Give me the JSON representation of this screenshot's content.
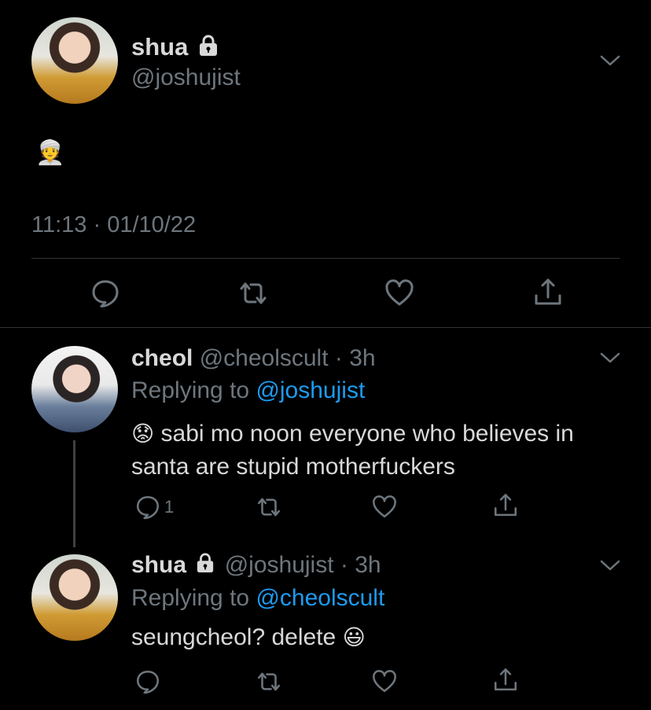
{
  "main_tweet": {
    "display_name": "shua",
    "handle": "@joshujist",
    "emoji": "👳",
    "time": "11:13 · 01/10/22"
  },
  "reply1": {
    "display_name": "cheol",
    "handle": "@cheolscult",
    "time": "· 3h",
    "replying_label": "Replying to",
    "replying_to": "@joshujist",
    "emoji": "😟",
    "text_line1": "sabi mo noon everyone who believes in",
    "text_line2": "santa are stupid motherfuckers",
    "reply_count": "1"
  },
  "reply2": {
    "display_name": "shua",
    "handle": "@joshujist",
    "time": "· 3h",
    "replying_label": "Replying to",
    "replying_to": "@cheolscult",
    "text": "seungcheol? delete",
    "emoji": "😃"
  },
  "icons": {
    "reply": "reply-icon",
    "retweet": "retweet-icon",
    "like": "heart-icon",
    "share": "share-icon",
    "lock": "lock-icon",
    "menu": "chevron-down-icon"
  },
  "colors": {
    "background": "#000000",
    "text": "#d9d9d9",
    "muted": "#6e767d",
    "link": "#1d9bf0",
    "divider": "#2f3336"
  }
}
